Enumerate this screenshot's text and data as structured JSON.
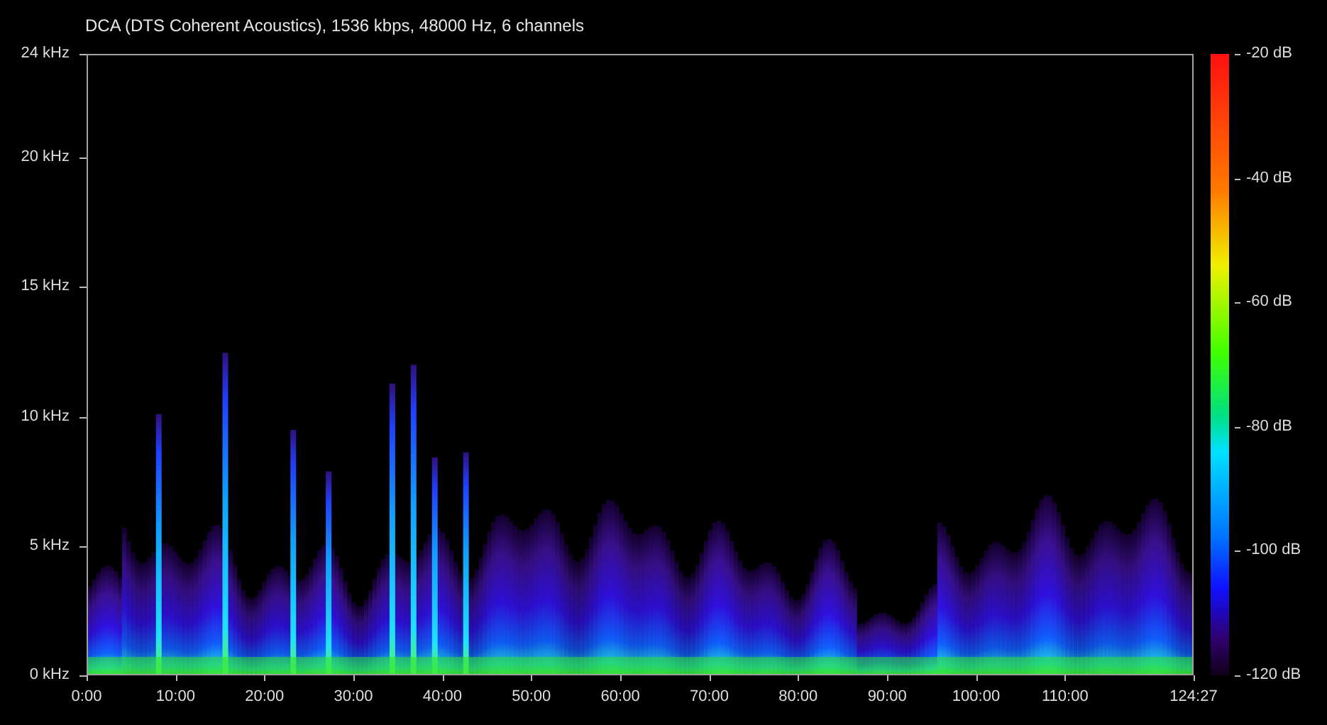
{
  "title": "DCA (DTS Coherent Acoustics), 1536 kbps, 48000 Hz, 6 channels",
  "y_axis": {
    "ticks": [
      "24 kHz",
      "20 kHz",
      "15 kHz",
      "10 kHz",
      "5 kHz",
      "0 kHz"
    ]
  },
  "x_axis": {
    "ticks": [
      "0:00",
      "10:00",
      "20:00",
      "30:00",
      "40:00",
      "50:00",
      "60:00",
      "70:00",
      "80:00",
      "90:00",
      "100:00",
      "110:00",
      "124:27"
    ]
  },
  "color_scale": {
    "labels": [
      "-20 dB",
      "-40 dB",
      "-60 dB",
      "-80 dB",
      "-100 dB",
      "-120 dB"
    ]
  }
}
